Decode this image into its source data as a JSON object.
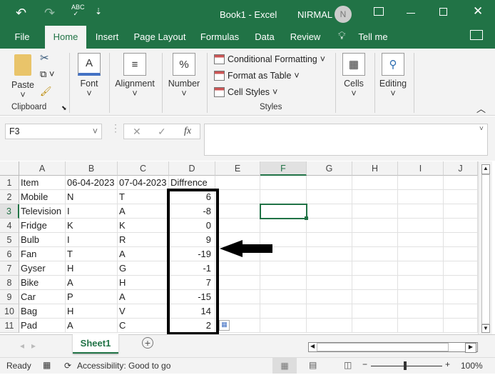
{
  "titlebar": {
    "title": "Book1  -  Excel",
    "user": "NIRMAL",
    "avatar": "N"
  },
  "tabs": [
    "File",
    "Home",
    "Insert",
    "Page Layout",
    "Formulas",
    "Data",
    "Review",
    "Tell me"
  ],
  "ribbon": {
    "paste": "Paste",
    "clipboard": "Clipboard",
    "font": "Font",
    "alignment": "Alignment",
    "number": "Number",
    "number_icon": "%",
    "conditional": "Conditional Formatting",
    "format_table": "Format as Table",
    "cell_styles": "Cell Styles",
    "styles": "Styles",
    "cells": "Cells",
    "editing": "Editing"
  },
  "formula": {
    "name_box": "F3",
    "fx": "fx",
    "value": ""
  },
  "columns": [
    "A",
    "B",
    "C",
    "D",
    "E",
    "F",
    "G",
    "H",
    "I",
    "J"
  ],
  "rows": [
    [
      "Item",
      "06-04-2023",
      "07-04-2023",
      "Diffrence"
    ],
    [
      "Mobile",
      "N",
      "T",
      "6"
    ],
    [
      "Television",
      "I",
      "A",
      "-8"
    ],
    [
      "Fridge",
      "K",
      "K",
      "0"
    ],
    [
      "Bulb",
      "I",
      "R",
      "9"
    ],
    [
      "Fan",
      "T",
      "A",
      "-19"
    ],
    [
      "Gyser",
      "H",
      "G",
      "-1"
    ],
    [
      "Bike",
      "A",
      "H",
      "7"
    ],
    [
      "Car",
      "P",
      "A",
      "-15"
    ],
    [
      "Bag",
      "H",
      "V",
      "14"
    ],
    [
      "Pad",
      "A",
      "C",
      "2"
    ]
  ],
  "selected_cell": "F3",
  "sheet": {
    "tab": "Sheet1"
  },
  "status": {
    "ready": "Ready",
    "accessibility": "Accessibility: Good to go",
    "zoom": "100%"
  },
  "colors": {
    "green": "#217346"
  }
}
